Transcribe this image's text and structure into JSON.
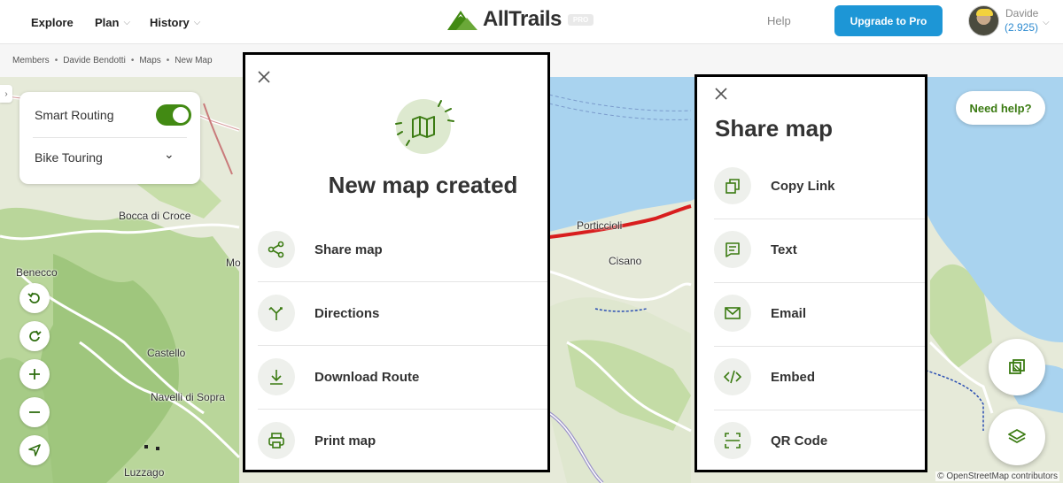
{
  "header": {
    "nav": [
      "Explore",
      "Plan",
      "History"
    ],
    "logo_text": "AllTrails",
    "pro_tag": "PRO",
    "help": "Help",
    "upgrade": "Upgrade to Pro",
    "user_name": "Davide",
    "user_points": "(2.925)"
  },
  "breadcrumb": [
    "Members",
    "Davide Bendotti",
    "Maps",
    "New Map"
  ],
  "routing": {
    "smart_routing_label": "Smart Routing",
    "smart_routing_on": true,
    "activity": "Bike Touring"
  },
  "map": {
    "labels": [
      "Bocca di Croce",
      "Benecco",
      "Castello",
      "Navelli di Sopra",
      "Luzzago",
      "Porticcioli",
      "Cisano",
      "Mo"
    ],
    "attribution": "© OpenStreetMap contributors",
    "need_help": "Need help?"
  },
  "new_map_panel": {
    "title": "New map created",
    "options": [
      {
        "label": "Share map",
        "icon": "share-icon"
      },
      {
        "label": "Directions",
        "icon": "directions-icon"
      },
      {
        "label": "Download Route",
        "icon": "download-icon"
      },
      {
        "label": "Print map",
        "icon": "print-icon"
      }
    ]
  },
  "share_panel": {
    "title": "Share map",
    "options": [
      {
        "label": "Copy Link",
        "icon": "copy-icon"
      },
      {
        "label": "Text",
        "icon": "message-icon"
      },
      {
        "label": "Email",
        "icon": "email-icon"
      },
      {
        "label": "Embed",
        "icon": "code-icon"
      },
      {
        "label": "QR Code",
        "icon": "qr-code-icon"
      }
    ]
  },
  "colors": {
    "brand_green": "#428a13",
    "upgrade_blue": "#1d96d6",
    "route_red": "#d81e1e",
    "water": "#a9d3ef"
  }
}
